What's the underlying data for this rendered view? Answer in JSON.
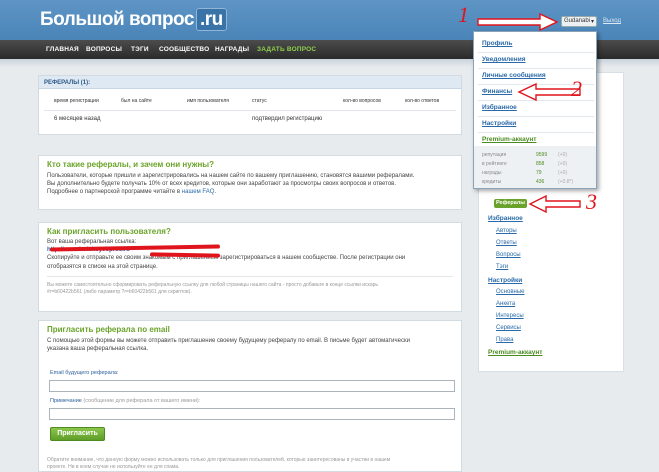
{
  "header": {
    "logo_main": "Большой вопрос",
    "logo_suffix": ".ru",
    "user_button": "Gudanabi",
    "logout": "Выход"
  },
  "nav": {
    "items": [
      "ГЛАВНАЯ",
      "ВОПРОСЫ",
      "ТЭГИ",
      "СООБЩЕСТВО",
      "НАГРАДЫ"
    ],
    "ask": "ЗАДАТЬ ВОПРОС"
  },
  "referrals": {
    "title": "РЕФЕРАЛЫ (1):",
    "columns": [
      "время регистрации",
      "был на сайте",
      "имя пользователя",
      "статус",
      "кол-во вопросов",
      "кол-во ответов"
    ],
    "row": {
      "time": "6 месяцев назад",
      "status": "подтвердил регистрацию"
    }
  },
  "who": {
    "title": "Кто такие рефералы, и зачем они нужны?",
    "lines": [
      "Пользователи, которые пришли и зарегистрировались на нашем сайте по вашему приглашению, становятся вашими рефералами.",
      "Вы дополнительно будете получать 10% от всех кредитов, которые они заработают за просмотры своих вопросов и ответов."
    ],
    "faq_prefix": "Подробнее о партнерской программе читайте в ",
    "faq_link": "нашем FAQ",
    "faq_suffix": "."
  },
  "how": {
    "title": "Как пригласить пользователя?",
    "link_label": "Вот ваша реферальная ссылка:",
    "link": "http://www.bolshoyvopros.ru",
    "copy_lines": [
      "Скопируйте и отправьте ее своим знакомым с приглашением зарегистрироваться в нашем сообществе. После регистрации они",
      "отобразятся в списке на этой странице."
    ],
    "note_lines": [
      "Вы можете самостоятельно сформировать реферальную ссылку для любой страницы нашего сайта - просто добавьте в конце ссылки искарь",
      "#r=b60422b561 (либо параметр ?r=b60422b561 для скриптов)."
    ]
  },
  "invite": {
    "title": "Пригласить реферала по email",
    "desc_lines": [
      "С помощью этой формы вы можете отправить приглашение своему будущему рефералу по email. В письме будет автоматически",
      "указана ваша реферальная ссылка."
    ],
    "email_label": "Email будущего реферала:",
    "note_label": "Примечание",
    "note_hint": "(сообщение для реферала от вашего имени):",
    "send": "Пригласить",
    "footer_lines": [
      "Обратите внимание, что данную форму можно использовать только для приглашения пользователей, которые заинтересованы в участии в нашем",
      "проекте. Ни в коем случае не используйте ее для спама."
    ]
  },
  "dropdown": {
    "items": [
      "Профиль",
      "Уведомления",
      "Личные сообщения",
      "Финансы",
      "Избранное",
      "Настройки",
      "Premium-аккаунт"
    ],
    "stats": [
      {
        "label": "репутация",
        "value": "9599",
        "sub": "(+0)"
      },
      {
        "label": "в рейтинге",
        "value": "858",
        "sub": "(+0)"
      },
      {
        "label": "награды",
        "value": "79",
        "sub": "(+0)"
      },
      {
        "label": "кредиты",
        "value": "436",
        "sub": "(+0.8*)"
      }
    ]
  },
  "sidebar": {
    "referrals_badge": "Рефералы",
    "favorites": "Избранное",
    "favorites_items": [
      "Авторы",
      "Ответы",
      "Вопросы",
      "Тэги"
    ],
    "settings": "Настройки",
    "settings_items": [
      "Основные",
      "Анкета",
      "Интересы",
      "Сервисы",
      "Права"
    ],
    "premium": "Premium-аккаунт"
  },
  "annotations": {
    "n1": "1",
    "n2": "2",
    "n3": "3"
  },
  "colors": {
    "header": "#4a84b8",
    "nav": "#333333",
    "accent_green": "#6aa329",
    "annotation_red": "#e0141c"
  }
}
